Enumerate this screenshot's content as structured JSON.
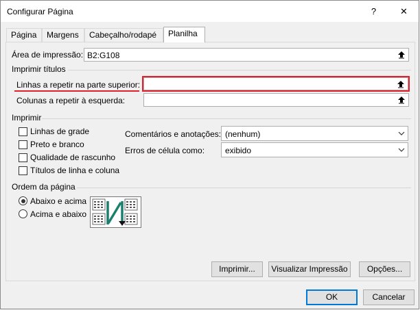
{
  "window": {
    "title": "Configurar Página",
    "help": "?",
    "close": "✕"
  },
  "tabs": [
    {
      "label": "Página"
    },
    {
      "label": "Margens"
    },
    {
      "label": "Cabeçalho/rodapé"
    },
    {
      "label": "Planilha",
      "active": true
    }
  ],
  "print_area": {
    "label": "Área de impressão:",
    "value": "B2:G108"
  },
  "print_titles": {
    "section": "Imprimir títulos",
    "rows_label": "Linhas a repetir na parte superior:",
    "rows_value": "",
    "cols_label": "Colunas a repetir à esquerda:",
    "cols_value": ""
  },
  "print": {
    "section": "Imprimir",
    "checkboxes": [
      {
        "label": "Linhas de grade",
        "checked": false
      },
      {
        "label": "Preto e branco",
        "checked": false
      },
      {
        "label": "Qualidade de rascunho",
        "checked": false
      },
      {
        "label": "Títulos de linha e coluna",
        "checked": false
      }
    ],
    "comments_label": "Comentários e anotações:",
    "comments_value": "(nenhum)",
    "errors_label": "Erros de célula como:",
    "errors_value": "exibido"
  },
  "page_order": {
    "section": "Ordem da página",
    "options": [
      {
        "label": "Abaixo e acima",
        "selected": true
      },
      {
        "label": "Acima e abaixo",
        "selected": false
      }
    ]
  },
  "buttons": {
    "print": "Imprimir...",
    "preview": "Visualizar Impressão",
    "options": "Opções...",
    "ok": "OK",
    "cancel": "Cancelar"
  },
  "colors": {
    "highlight": "#e0202c",
    "accent": "#0078d7",
    "arrow": "#1b7f6e"
  }
}
